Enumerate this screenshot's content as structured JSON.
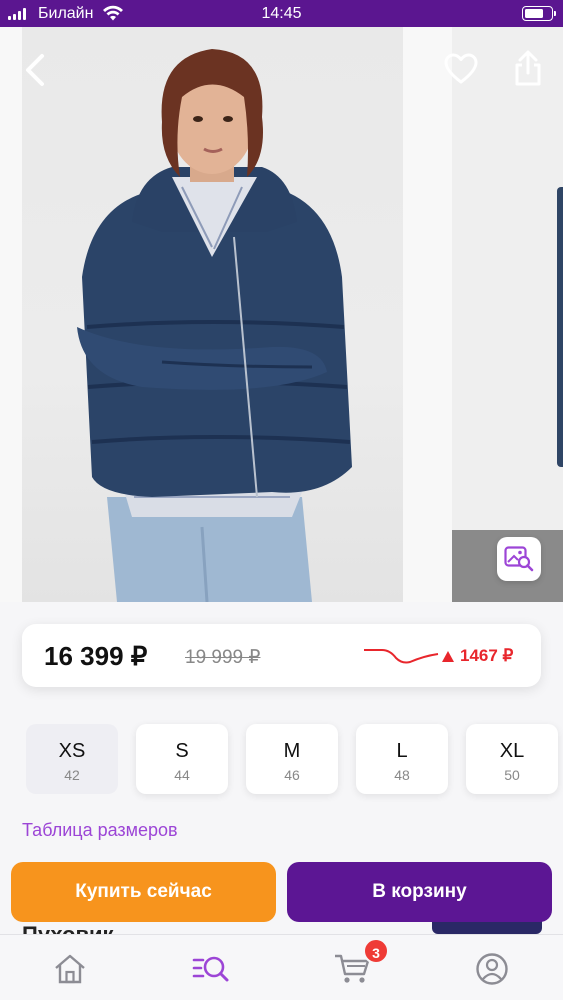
{
  "status_bar": {
    "carrier": "Билайн",
    "time": "14:45",
    "battery_level": 0.7
  },
  "gallery": {
    "icons": {
      "back": "chevron-left-icon",
      "favorite": "heart-icon",
      "share": "share-icon",
      "visual_search": "image-search-icon"
    }
  },
  "price": {
    "current": "16 399 ₽",
    "old": "19 999 ₽",
    "diff": "1467 ₽",
    "trend": "down"
  },
  "sizes": [
    {
      "label": "XS",
      "ru": "42",
      "selected": true
    },
    {
      "label": "S",
      "ru": "44",
      "selected": false
    },
    {
      "label": "M",
      "ru": "46",
      "selected": false
    },
    {
      "label": "L",
      "ru": "48",
      "selected": false
    },
    {
      "label": "XL",
      "ru": "50",
      "selected": false
    }
  ],
  "size_table_link": "Таблица размеров",
  "product_title_peek": "Пуховик",
  "actions": {
    "buy_now": "Купить сейчас",
    "add_to_cart": "В корзину"
  },
  "tabbar": {
    "items": [
      "home-icon",
      "catalog-search-icon",
      "cart-icon",
      "profile-icon"
    ],
    "cart_badge": "3"
  },
  "colors": {
    "brand_purple": "#5c1694",
    "buy_orange": "#f7941d",
    "accent_link": "#9c45d6",
    "price_drop_red": "#e8262c"
  }
}
